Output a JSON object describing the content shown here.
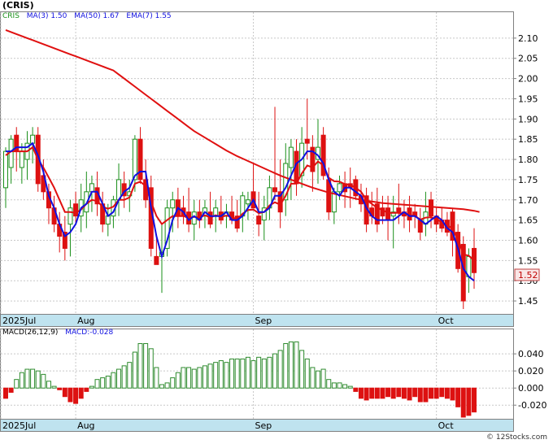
{
  "header": {
    "ticker": "(CRIS)"
  },
  "price_legend": {
    "symbol": "CRIS",
    "ma3": "MA(3)  1.50",
    "ma50": "MA(50)  1.67",
    "ema7": "EMA(7)  1.55"
  },
  "macd_legend": {
    "params": "MACD(26,12,9)",
    "value": "MACD:-0.028"
  },
  "last_price_label": "1.52",
  "watermark": "© 12Stocks.com",
  "colors": {
    "up": "#1a8f1a",
    "down": "#dd1111",
    "ma50": "#e01010",
    "ma3": "#1010e0",
    "axisStrip": "#bfe3ef",
    "grid": "#c8c8c8",
    "macdUp": "#2e8b2e",
    "macdDown": "#dd1111"
  },
  "chart_data": [
    {
      "type": "candlestick",
      "title": "CRIS",
      "xlabels": [
        "2025Jul",
        "Aug",
        "Sep",
        "Oct"
      ],
      "xlabel_index": [
        0,
        13,
        46,
        80
      ],
      "ylim": [
        1.42,
        2.15
      ],
      "yticks": [
        1.45,
        1.5,
        1.55,
        1.6,
        1.65,
        1.7,
        1.75,
        1.8,
        1.85,
        1.9,
        1.95,
        2.0,
        2.05,
        2.1
      ],
      "candles": [
        {
          "o": 1.73,
          "h": 1.83,
          "l": 1.68,
          "c": 1.82
        },
        {
          "o": 1.78,
          "h": 1.86,
          "l": 1.74,
          "c": 1.85
        },
        {
          "o": 1.86,
          "h": 1.88,
          "l": 1.77,
          "c": 1.82
        },
        {
          "o": 1.78,
          "h": 1.84,
          "l": 1.74,
          "c": 1.82
        },
        {
          "o": 1.8,
          "h": 1.87,
          "l": 1.75,
          "c": 1.84
        },
        {
          "o": 1.84,
          "h": 1.88,
          "l": 1.79,
          "c": 1.86
        },
        {
          "o": 1.86,
          "h": 1.88,
          "l": 1.72,
          "c": 1.74
        },
        {
          "o": 1.76,
          "h": 1.8,
          "l": 1.7,
          "c": 1.72
        },
        {
          "o": 1.72,
          "h": 1.74,
          "l": 1.64,
          "c": 1.68
        },
        {
          "o": 1.68,
          "h": 1.71,
          "l": 1.62,
          "c": 1.64
        },
        {
          "o": 1.64,
          "h": 1.67,
          "l": 1.57,
          "c": 1.61
        },
        {
          "o": 1.62,
          "h": 1.66,
          "l": 1.55,
          "c": 1.58
        },
        {
          "o": 1.64,
          "h": 1.7,
          "l": 1.56,
          "c": 1.68
        },
        {
          "o": 1.69,
          "h": 1.72,
          "l": 1.64,
          "c": 1.66
        },
        {
          "o": 1.66,
          "h": 1.74,
          "l": 1.62,
          "c": 1.7
        },
        {
          "o": 1.67,
          "h": 1.77,
          "l": 1.63,
          "c": 1.72
        },
        {
          "o": 1.72,
          "h": 1.76,
          "l": 1.67,
          "c": 1.74
        },
        {
          "o": 1.73,
          "h": 1.77,
          "l": 1.66,
          "c": 1.69
        },
        {
          "o": 1.69,
          "h": 1.72,
          "l": 1.62,
          "c": 1.64
        },
        {
          "o": 1.64,
          "h": 1.69,
          "l": 1.61,
          "c": 1.66
        },
        {
          "o": 1.66,
          "h": 1.71,
          "l": 1.63,
          "c": 1.7
        },
        {
          "o": 1.7,
          "h": 1.79,
          "l": 1.66,
          "c": 1.75
        },
        {
          "o": 1.74,
          "h": 1.77,
          "l": 1.68,
          "c": 1.71
        },
        {
          "o": 1.71,
          "h": 1.75,
          "l": 1.67,
          "c": 1.72
        },
        {
          "o": 1.75,
          "h": 1.86,
          "l": 1.72,
          "c": 1.85
        },
        {
          "o": 1.85,
          "h": 1.88,
          "l": 1.74,
          "c": 1.75
        },
        {
          "o": 1.75,
          "h": 1.8,
          "l": 1.68,
          "c": 1.7
        },
        {
          "o": 1.73,
          "h": 1.76,
          "l": 1.56,
          "c": 1.58
        },
        {
          "o": 1.56,
          "h": 1.61,
          "l": 1.54,
          "c": 1.54
        },
        {
          "o": 1.56,
          "h": 1.64,
          "l": 1.47,
          "c": 1.57
        },
        {
          "o": 1.58,
          "h": 1.7,
          "l": 1.56,
          "c": 1.68
        },
        {
          "o": 1.68,
          "h": 1.72,
          "l": 1.62,
          "c": 1.7
        },
        {
          "o": 1.7,
          "h": 1.73,
          "l": 1.63,
          "c": 1.66
        },
        {
          "o": 1.68,
          "h": 1.71,
          "l": 1.64,
          "c": 1.66
        },
        {
          "o": 1.67,
          "h": 1.73,
          "l": 1.62,
          "c": 1.64
        },
        {
          "o": 1.64,
          "h": 1.7,
          "l": 1.6,
          "c": 1.67
        },
        {
          "o": 1.67,
          "h": 1.7,
          "l": 1.63,
          "c": 1.65
        },
        {
          "o": 1.66,
          "h": 1.7,
          "l": 1.63,
          "c": 1.68
        },
        {
          "o": 1.67,
          "h": 1.72,
          "l": 1.63,
          "c": 1.64
        },
        {
          "o": 1.66,
          "h": 1.7,
          "l": 1.62,
          "c": 1.68
        },
        {
          "o": 1.67,
          "h": 1.71,
          "l": 1.64,
          "c": 1.65
        },
        {
          "o": 1.66,
          "h": 1.69,
          "l": 1.63,
          "c": 1.67
        },
        {
          "o": 1.67,
          "h": 1.71,
          "l": 1.64,
          "c": 1.65
        },
        {
          "o": 1.66,
          "h": 1.7,
          "l": 1.62,
          "c": 1.63
        },
        {
          "o": 1.66,
          "h": 1.72,
          "l": 1.62,
          "c": 1.71
        },
        {
          "o": 1.69,
          "h": 1.72,
          "l": 1.65,
          "c": 1.7
        },
        {
          "o": 1.72,
          "h": 1.79,
          "l": 1.68,
          "c": 1.68
        },
        {
          "o": 1.66,
          "h": 1.72,
          "l": 1.61,
          "c": 1.64
        },
        {
          "o": 1.65,
          "h": 1.71,
          "l": 1.6,
          "c": 1.68
        },
        {
          "o": 1.68,
          "h": 1.76,
          "l": 1.65,
          "c": 1.73
        },
        {
          "o": 1.73,
          "h": 1.93,
          "l": 1.7,
          "c": 1.72
        },
        {
          "o": 1.72,
          "h": 1.8,
          "l": 1.63,
          "c": 1.67
        },
        {
          "o": 1.7,
          "h": 1.84,
          "l": 1.66,
          "c": 1.79
        },
        {
          "o": 1.78,
          "h": 1.85,
          "l": 1.7,
          "c": 1.83
        },
        {
          "o": 1.82,
          "h": 1.85,
          "l": 1.71,
          "c": 1.74
        },
        {
          "o": 1.76,
          "h": 1.88,
          "l": 1.73,
          "c": 1.84
        },
        {
          "o": 1.85,
          "h": 1.95,
          "l": 1.8,
          "c": 1.84
        },
        {
          "o": 1.83,
          "h": 1.86,
          "l": 1.72,
          "c": 1.77
        },
        {
          "o": 1.8,
          "h": 1.9,
          "l": 1.74,
          "c": 1.83
        },
        {
          "o": 1.86,
          "h": 1.88,
          "l": 1.75,
          "c": 1.76
        },
        {
          "o": 1.75,
          "h": 1.78,
          "l": 1.65,
          "c": 1.67
        },
        {
          "o": 1.67,
          "h": 1.73,
          "l": 1.64,
          "c": 1.72
        },
        {
          "o": 1.72,
          "h": 1.76,
          "l": 1.7,
          "c": 1.74
        },
        {
          "o": 1.74,
          "h": 1.77,
          "l": 1.68,
          "c": 1.72
        },
        {
          "o": 1.74,
          "h": 1.78,
          "l": 1.68,
          "c": 1.73
        },
        {
          "o": 1.75,
          "h": 1.76,
          "l": 1.7,
          "c": 1.71
        },
        {
          "o": 1.71,
          "h": 1.74,
          "l": 1.67,
          "c": 1.69
        },
        {
          "o": 1.71,
          "h": 1.73,
          "l": 1.62,
          "c": 1.64
        },
        {
          "o": 1.68,
          "h": 1.72,
          "l": 1.64,
          "c": 1.66
        },
        {
          "o": 1.69,
          "h": 1.73,
          "l": 1.62,
          "c": 1.64
        },
        {
          "o": 1.68,
          "h": 1.71,
          "l": 1.64,
          "c": 1.66
        },
        {
          "o": 1.68,
          "h": 1.71,
          "l": 1.6,
          "c": 1.65
        },
        {
          "o": 1.66,
          "h": 1.71,
          "l": 1.58,
          "c": 1.67
        },
        {
          "o": 1.68,
          "h": 1.74,
          "l": 1.64,
          "c": 1.67
        },
        {
          "o": 1.67,
          "h": 1.7,
          "l": 1.63,
          "c": 1.66
        },
        {
          "o": 1.68,
          "h": 1.71,
          "l": 1.62,
          "c": 1.65
        },
        {
          "o": 1.67,
          "h": 1.69,
          "l": 1.63,
          "c": 1.66
        },
        {
          "o": 1.65,
          "h": 1.68,
          "l": 1.6,
          "c": 1.62
        },
        {
          "o": 1.64,
          "h": 1.72,
          "l": 1.61,
          "c": 1.67
        },
        {
          "o": 1.7,
          "h": 1.72,
          "l": 1.63,
          "c": 1.66
        },
        {
          "o": 1.66,
          "h": 1.68,
          "l": 1.62,
          "c": 1.64
        },
        {
          "o": 1.65,
          "h": 1.68,
          "l": 1.62,
          "c": 1.63
        },
        {
          "o": 1.65,
          "h": 1.67,
          "l": 1.61,
          "c": 1.62
        },
        {
          "o": 1.67,
          "h": 1.68,
          "l": 1.56,
          "c": 1.6
        },
        {
          "o": 1.62,
          "h": 1.64,
          "l": 1.52,
          "c": 1.53
        },
        {
          "o": 1.59,
          "h": 1.61,
          "l": 1.43,
          "c": 1.45
        },
        {
          "o": 1.51,
          "h": 1.58,
          "l": 1.47,
          "c": 1.56
        },
        {
          "o": 1.58,
          "h": 1.63,
          "l": 1.48,
          "c": 1.52
        }
      ],
      "series": [
        {
          "name": "MA(50)",
          "color": "#e01010",
          "values": [
            2.12,
            2.115,
            2.11,
            2.105,
            2.1,
            2.095,
            2.09,
            2.085,
            2.08,
            2.075,
            2.07,
            2.065,
            2.06,
            2.055,
            2.05,
            2.045,
            2.04,
            2.035,
            2.03,
            2.025,
            2.02,
            2.01,
            2.0,
            1.99,
            1.98,
            1.97,
            1.96,
            1.95,
            1.94,
            1.93,
            1.92,
            1.91,
            1.9,
            1.89,
            1.88,
            1.87,
            1.862,
            1.854,
            1.846,
            1.838,
            1.83,
            1.822,
            1.815,
            1.808,
            1.802,
            1.796,
            1.79,
            1.784,
            1.778,
            1.772,
            1.766,
            1.76,
            1.755,
            1.75,
            1.745,
            1.74,
            1.735,
            1.73,
            1.726,
            1.722,
            1.718,
            1.715,
            1.712,
            1.709,
            1.706,
            1.703,
            1.7,
            1.698,
            1.696,
            1.694,
            1.692,
            1.691,
            1.69,
            1.689,
            1.688,
            1.687,
            1.686,
            1.685,
            1.684,
            1.683,
            1.682,
            1.681,
            1.68,
            1.679,
            1.678,
            1.677,
            1.675,
            1.673,
            1.67
          ]
        },
        {
          "name": "EMA(7)",
          "color": "#e01010",
          "values": [
            1.81,
            1.82,
            1.82,
            1.82,
            1.82,
            1.83,
            1.8,
            1.78,
            1.755,
            1.73,
            1.7,
            1.67,
            1.67,
            1.668,
            1.676,
            1.69,
            1.7,
            1.697,
            1.683,
            1.678,
            1.683,
            1.7,
            1.7,
            1.706,
            1.74,
            1.745,
            1.734,
            1.695,
            1.66,
            1.64,
            1.65,
            1.66,
            1.66,
            1.66,
            1.655,
            1.658,
            1.656,
            1.662,
            1.656,
            1.662,
            1.658,
            1.661,
            1.658,
            1.651,
            1.666,
            1.675,
            1.676,
            1.667,
            1.67,
            1.686,
            1.694,
            1.688,
            1.71,
            1.74,
            1.74,
            1.765,
            1.785,
            1.78,
            1.795,
            1.785,
            1.755,
            1.746,
            1.745,
            1.739,
            1.737,
            1.73,
            1.72,
            1.7,
            1.69,
            1.68,
            1.675,
            1.668,
            1.668,
            1.668,
            1.666,
            1.662,
            1.661,
            1.651,
            1.656,
            1.657,
            1.652,
            1.645,
            1.638,
            1.628,
            1.604,
            1.565,
            1.562,
            1.55
          ]
        },
        {
          "name": "MA(3)",
          "color": "#1010e0",
          "values": [
            1.82,
            1.82,
            1.83,
            1.83,
            1.83,
            1.84,
            1.81,
            1.77,
            1.71,
            1.68,
            1.64,
            1.61,
            1.62,
            1.64,
            1.68,
            1.69,
            1.72,
            1.72,
            1.69,
            1.66,
            1.67,
            1.7,
            1.72,
            1.73,
            1.76,
            1.77,
            1.77,
            1.68,
            1.61,
            1.56,
            1.6,
            1.65,
            1.68,
            1.67,
            1.65,
            1.66,
            1.65,
            1.67,
            1.66,
            1.66,
            1.66,
            1.67,
            1.65,
            1.65,
            1.66,
            1.68,
            1.7,
            1.67,
            1.67,
            1.68,
            1.71,
            1.71,
            1.73,
            1.76,
            1.79,
            1.8,
            1.82,
            1.82,
            1.81,
            1.79,
            1.75,
            1.72,
            1.71,
            1.73,
            1.73,
            1.72,
            1.71,
            1.68,
            1.66,
            1.65,
            1.65,
            1.65,
            1.65,
            1.66,
            1.67,
            1.66,
            1.66,
            1.65,
            1.64,
            1.65,
            1.66,
            1.65,
            1.63,
            1.62,
            1.58,
            1.53,
            1.51,
            1.5
          ]
        }
      ]
    },
    {
      "type": "bar",
      "title": "MACD(26,12,9)",
      "xlabels": [
        "2025Jul",
        "Aug",
        "Sep",
        "Oct"
      ],
      "xlabel_index": [
        0,
        13,
        46,
        80
      ],
      "ylim": [
        -0.035,
        0.062
      ],
      "yticks": [
        -0.02,
        0.0,
        0.02,
        0.04
      ],
      "ytick_labels": [
        "-0.020",
        "0.000",
        "0.020",
        "0.040"
      ],
      "values": [
        -0.012,
        -0.005,
        0.01,
        0.018,
        0.022,
        0.022,
        0.02,
        0.016,
        0.008,
        0.002,
        -0.002,
        -0.01,
        -0.016,
        -0.018,
        -0.012,
        -0.004,
        0.002,
        0.01,
        0.012,
        0.014,
        0.018,
        0.022,
        0.026,
        0.03,
        0.042,
        0.052,
        0.052,
        0.046,
        0.024,
        0.004,
        0.006,
        0.012,
        0.018,
        0.024,
        0.024,
        0.022,
        0.024,
        0.026,
        0.028,
        0.03,
        0.032,
        0.03,
        0.034,
        0.034,
        0.034,
        0.036,
        0.032,
        0.036,
        0.034,
        0.036,
        0.04,
        0.044,
        0.052,
        0.054,
        0.054,
        0.044,
        0.034,
        0.024,
        0.02,
        0.022,
        0.01,
        0.006,
        0.006,
        0.004,
        0.002,
        -0.004,
        -0.012,
        -0.014,
        -0.012,
        -0.012,
        -0.012,
        -0.01,
        -0.012,
        -0.01,
        -0.012,
        -0.014,
        -0.01,
        -0.016,
        -0.016,
        -0.012,
        -0.012,
        -0.01,
        -0.012,
        -0.014,
        -0.022,
        -0.034,
        -0.032,
        -0.028
      ]
    }
  ]
}
